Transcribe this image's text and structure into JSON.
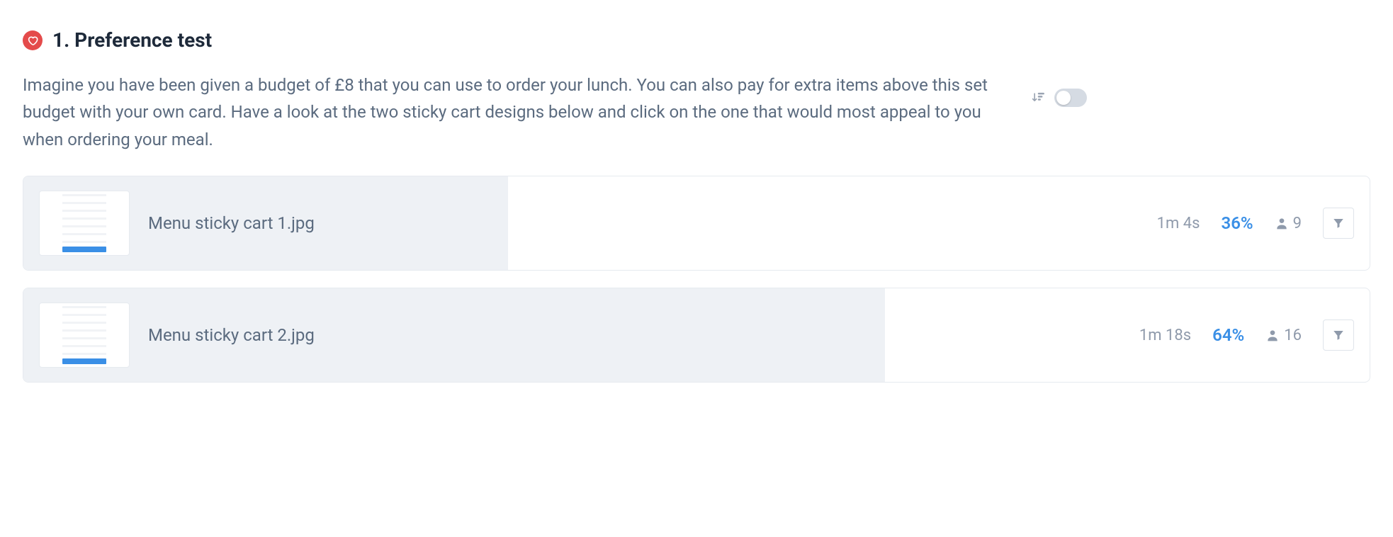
{
  "section": {
    "icon": "heart-icon",
    "title": "1. Preference test",
    "description": "Imagine you have been given a budget of £8 that you can use to order your lunch. You can also pay for extra items above this set budget with your own card. Have a look at the two sticky cart designs below and click on the one that would most appeal to you when ordering your meal."
  },
  "controls": {
    "sort_icon": "sort-descending-icon",
    "toggle_state": "off"
  },
  "results": [
    {
      "filename": "Menu sticky cart 1.jpg",
      "time": "1m 4s",
      "percent": "36%",
      "percent_value": 36,
      "participants": "9"
    },
    {
      "filename": "Menu sticky cart 2.jpg",
      "time": "1m 18s",
      "percent": "64%",
      "percent_value": 64,
      "participants": "16"
    }
  ]
}
